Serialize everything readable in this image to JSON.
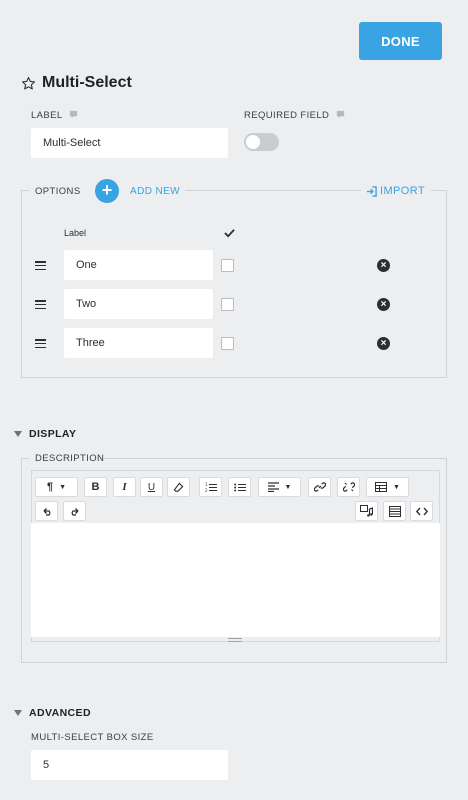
{
  "header": {
    "done_label": "DONE"
  },
  "field": {
    "title": "Multi-Select",
    "label_caption": "LABEL",
    "label_value": "Multi-Select",
    "required_caption": "REQUIRED FIELD",
    "required_on": false
  },
  "options": {
    "caption": "OPTIONS",
    "add_new": "ADD NEW",
    "import": "IMPORT",
    "column_label": "Label",
    "items": [
      {
        "label": "One",
        "checked": false
      },
      {
        "label": "Two",
        "checked": false
      },
      {
        "label": "Three",
        "checked": false
      }
    ]
  },
  "display": {
    "section_title": "DISPLAY",
    "description_caption": "DESCRIPTION",
    "toolbar": {
      "paragraph": "¶",
      "bold": "B",
      "italic": "I",
      "underline": "U"
    }
  },
  "advanced": {
    "section_title": "ADVANCED",
    "box_size_caption": "MULTI-SELECT BOX SIZE",
    "box_size_value": "5"
  },
  "colors": {
    "accent": "#3aa3e3",
    "background": "#eceef0",
    "text": "#2b2f33"
  }
}
